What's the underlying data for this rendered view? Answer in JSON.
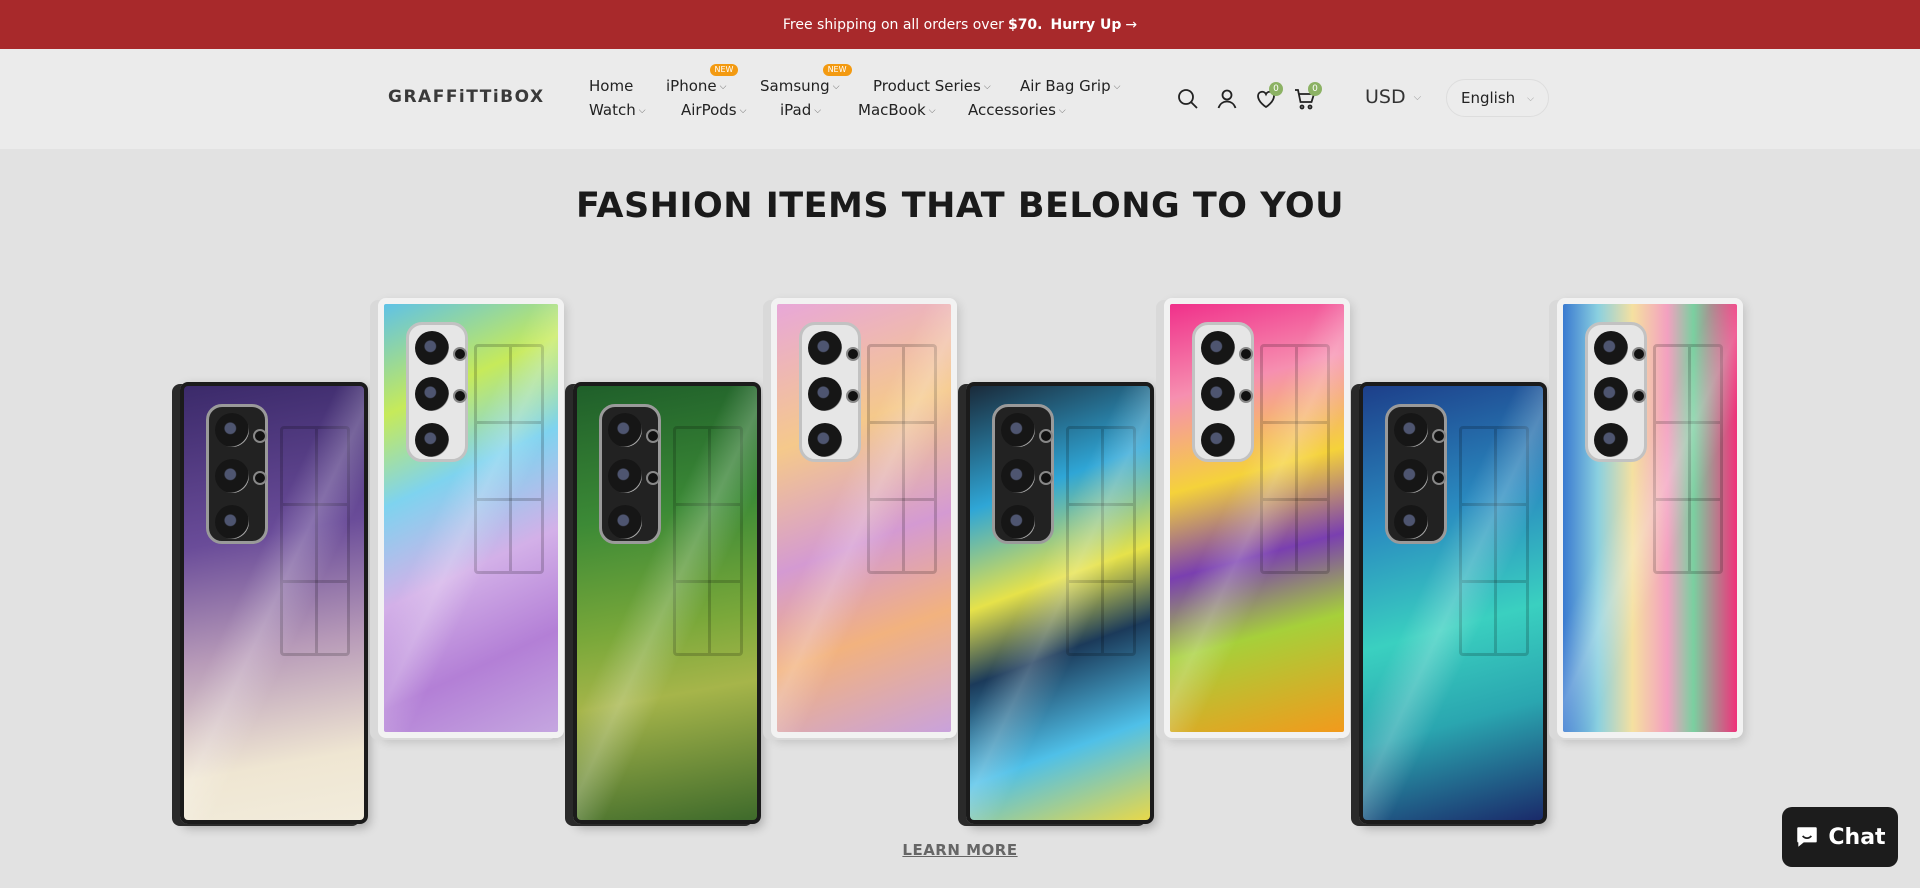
{
  "announcement": {
    "text_before": "Free shipping on all orders over",
    "amount": "$70.",
    "cta": "Hurry Up",
    "arrow": "→"
  },
  "header": {
    "logo": "GRAFFiTTiBOX",
    "nav": [
      {
        "label": "Home"
      },
      {
        "label": "iPhone",
        "badge": "NEW"
      },
      {
        "label": "Samsung",
        "badge": "NEW"
      },
      {
        "label": "Product Series"
      },
      {
        "label": "Air Bag Grip"
      },
      {
        "label": "Watch"
      },
      {
        "label": "AirPods"
      },
      {
        "label": "iPad"
      },
      {
        "label": "MacBook"
      },
      {
        "label": "Accessories"
      }
    ],
    "wishlist_count": "0",
    "cart_count": "0",
    "currency": "USD",
    "language": "English",
    "chevron": "⌵"
  },
  "hero": {
    "title": "FASHION ITEMS THAT BELONG TO YOU",
    "cta": "LEARN MORE"
  },
  "chat": {
    "label": "Chat"
  },
  "colors": {
    "announcement_bg": "#a8292b",
    "badge": "#f39a11",
    "count_badge": "#8cb264"
  },
  "icons": [
    "search-icon",
    "account-icon",
    "heart-icon",
    "cart-icon",
    "chat-bubble-icon"
  ]
}
